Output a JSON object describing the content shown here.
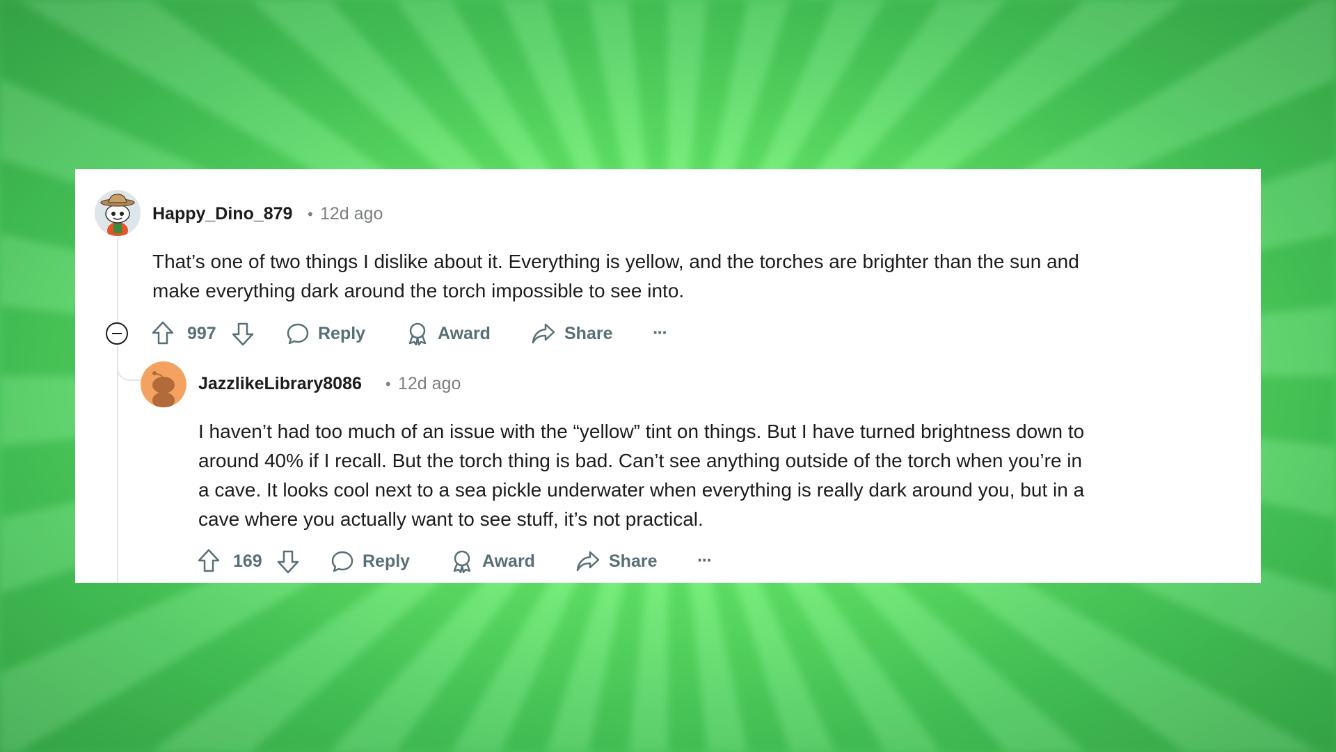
{
  "comments": [
    {
      "username": "Happy_Dino_879",
      "separator": "•",
      "time": "12d ago",
      "body_lines": [
        "That’s one of two things I dislike about it. Everything is yellow, and the torches are brighter than the sun and",
        "make everything dark around the torch impossible to see into."
      ],
      "votes": "997",
      "reply_label": "Reply",
      "award_label": "Award",
      "share_label": "Share",
      "more_label": "···"
    },
    {
      "username": "JazzlikeLibrary8086",
      "separator": "•",
      "time": "12d ago",
      "body_lines": [
        "I haven’t had too much of an issue with the “yellow” tint on things. But I have turned brightness down to",
        "around 40% if I recall. But the torch thing is bad. Can’t see anything outside of the torch when you’re in",
        "a cave. It looks cool next to a sea pickle underwater when everything is really dark around you, but in a",
        "cave where you actually want to see stuff, it’s not practical."
      ],
      "votes": "169",
      "reply_label": "Reply",
      "award_label": "Award",
      "share_label": "Share",
      "more_label": "···"
    }
  ],
  "colors": {
    "background_green": "#6cf06f",
    "text": "#1c1c1c",
    "meta": "#7c7f82",
    "action": "#576f76",
    "avatar2": "#f4a261"
  }
}
